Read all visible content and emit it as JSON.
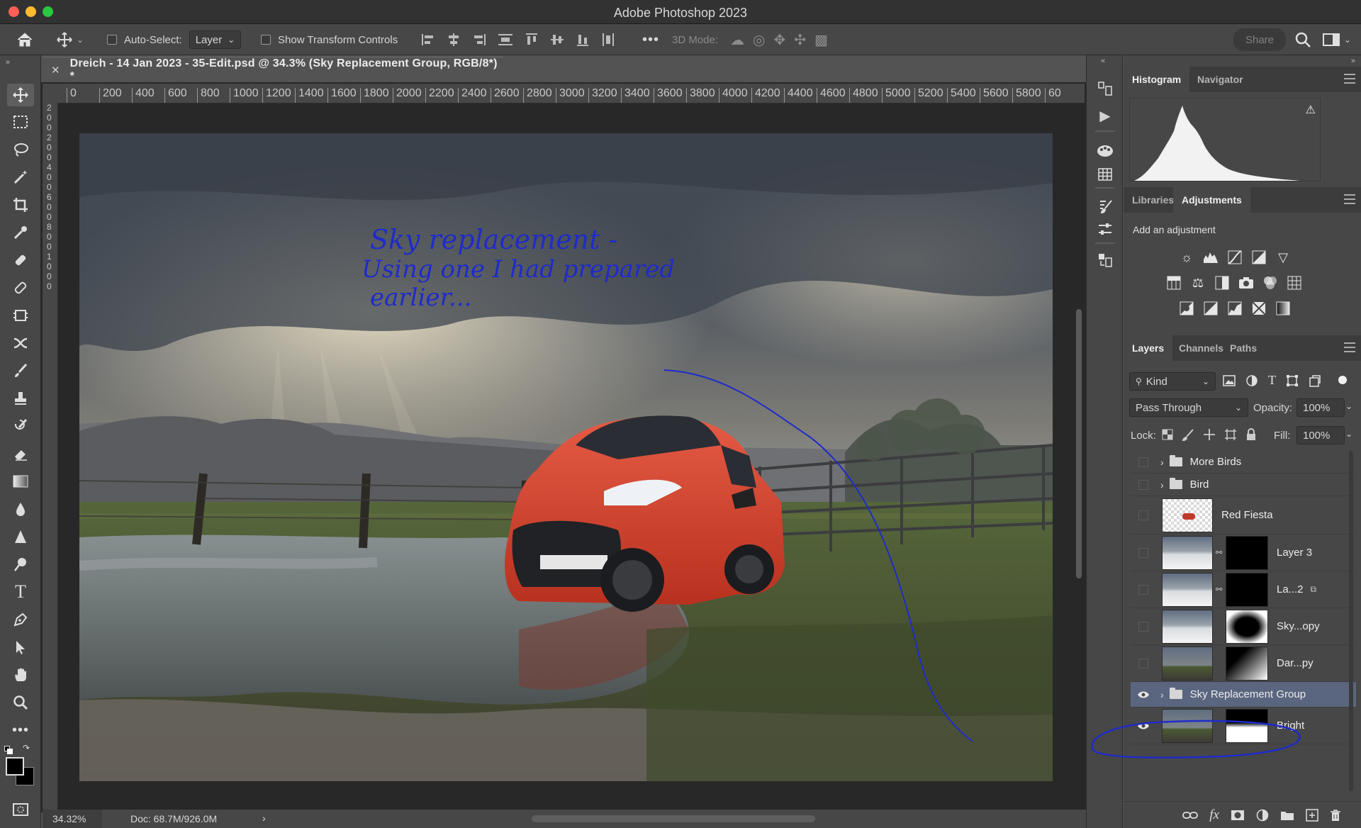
{
  "app": {
    "title": "Adobe Photoshop 2023"
  },
  "options_bar": {
    "auto_select_label": "Auto-Select:",
    "auto_select_value": "Layer",
    "show_transform_label": "Show Transform Controls",
    "mode_3d_label": "3D Mode:",
    "share_label": "Share"
  },
  "document": {
    "tab_title": "Dreich - 14 Jan 2023 - 35-Edit.psd @ 34.3% (Sky Replacement Group, RGB/8*) *",
    "ruler_top": [
      "0",
      "200",
      "400",
      "600",
      "800",
      "1000",
      "1200",
      "1400",
      "1600",
      "1800",
      "2000",
      "2200",
      "2400",
      "2600",
      "2800",
      "3000",
      "3200",
      "3400",
      "3600",
      "3800",
      "4000",
      "4200",
      "4400",
      "4600",
      "4800",
      "5000",
      "5200",
      "5400",
      "5600",
      "5800",
      "60"
    ],
    "ruler_left": [
      "2",
      "0",
      "0",
      "2",
      "0",
      "0",
      "4",
      "0",
      "0",
      "6",
      "0",
      "0",
      "8",
      "0",
      "0",
      "1",
      "0",
      "0",
      "0"
    ],
    "annotation_lines": [
      "Sky replacement -",
      "Using one I had prepared",
      "earlier..."
    ]
  },
  "status": {
    "zoom": "34.32%",
    "doc_size": "Doc: 68.7M/926.0M"
  },
  "panels": {
    "histogram": {
      "tabs": [
        "Histogram",
        "Navigator"
      ]
    },
    "adjustments": {
      "tabs": [
        "Libraries",
        "Adjustments"
      ],
      "heading": "Add an adjustment"
    },
    "layers": {
      "tabs": [
        "Layers",
        "Channels",
        "Paths"
      ],
      "filter_kind": "Kind",
      "blend_mode": "Pass Through",
      "opacity_label": "Opacity:",
      "opacity_value": "100%",
      "lock_label": "Lock:",
      "fill_label": "Fill:",
      "fill_value": "100%",
      "items": [
        {
          "name": "More Birds",
          "type": "group",
          "visible": false
        },
        {
          "name": "Bird",
          "type": "group",
          "visible": false
        },
        {
          "name": "Red Fiesta",
          "type": "layer",
          "visible": false
        },
        {
          "name": "Layer 3",
          "type": "masked",
          "visible": false
        },
        {
          "name": "La...2",
          "type": "masked",
          "visible": false
        },
        {
          "name": "Sky...opy",
          "type": "masked",
          "visible": false
        },
        {
          "name": "Dar...py",
          "type": "masked",
          "visible": false
        },
        {
          "name": "Sky Replacement Group",
          "type": "group",
          "visible": true,
          "selected": true
        },
        {
          "name": "Bright",
          "type": "masked",
          "visible": true
        }
      ]
    }
  },
  "colors": {
    "annotation": "#1f2bc9",
    "selected_layer": "#5a6680",
    "accent": "#4a78c4"
  }
}
